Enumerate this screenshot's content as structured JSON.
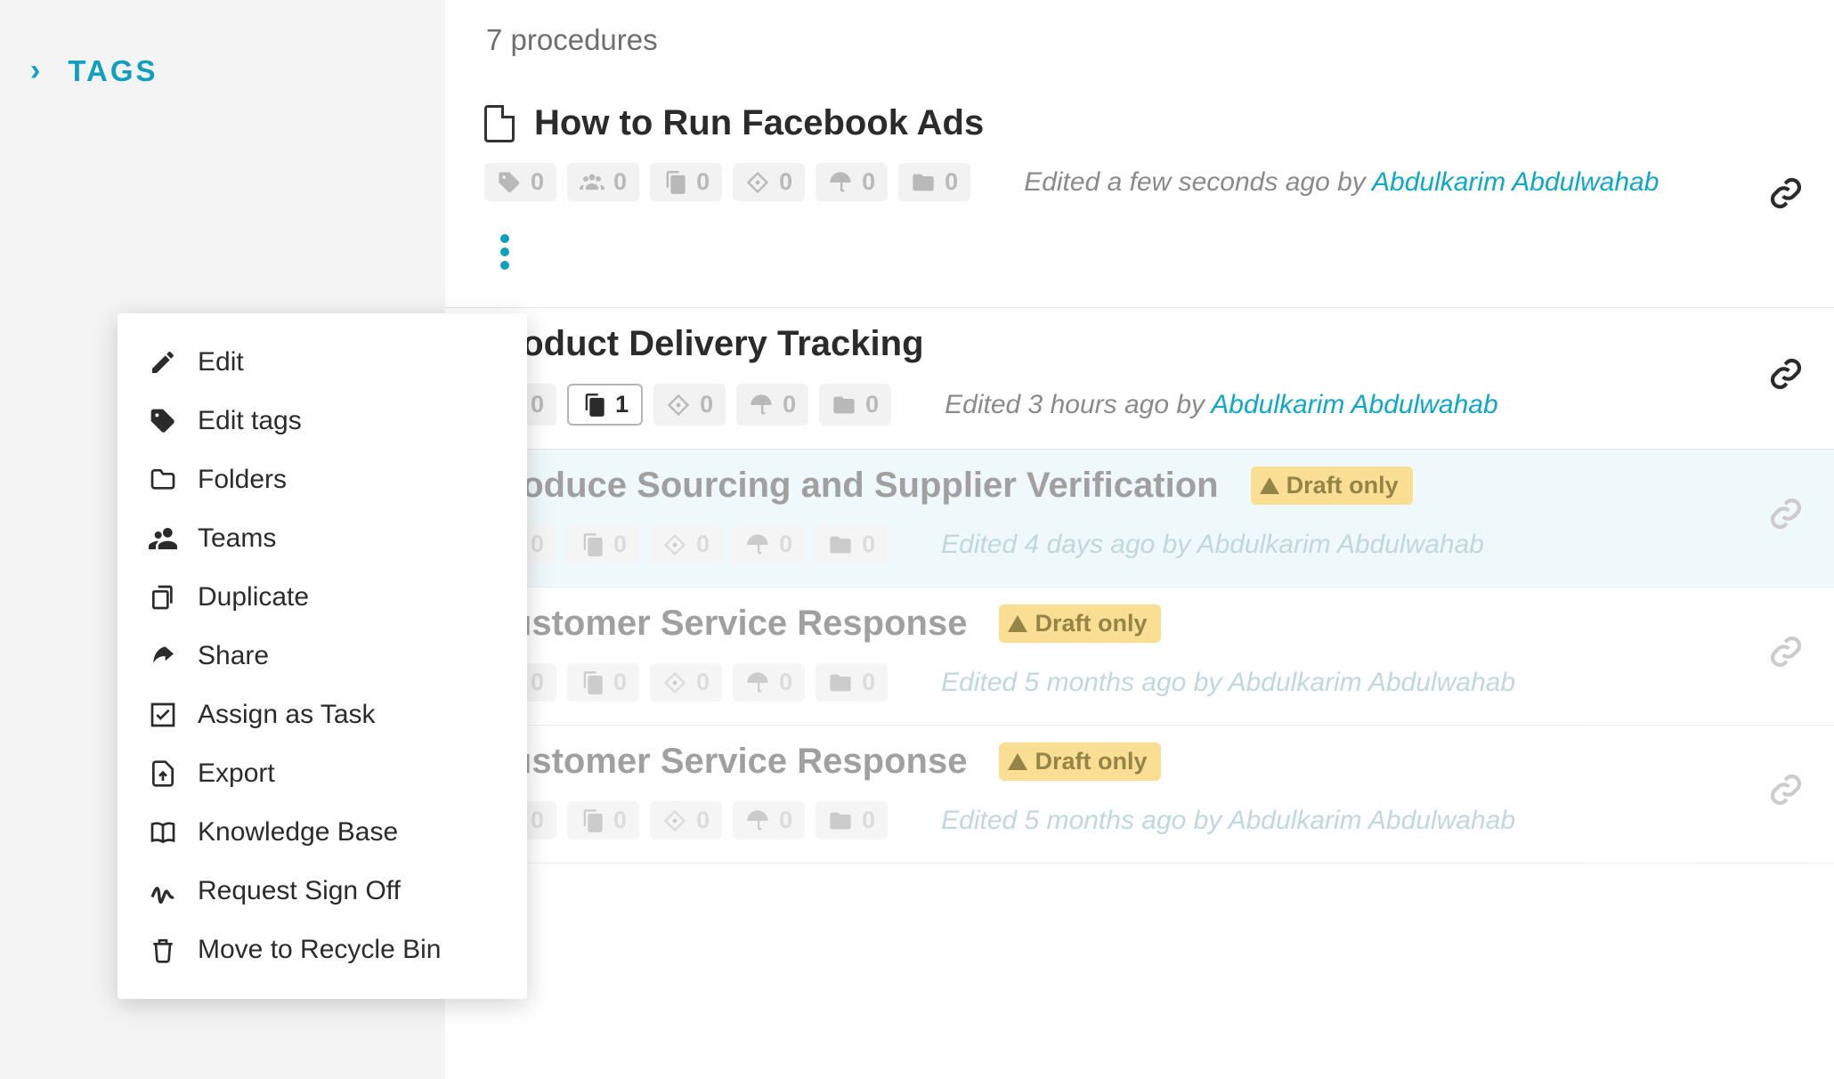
{
  "sidebar": {
    "tags_label": "TAGS"
  },
  "count_label": "7 procedures",
  "user_link": "Abdulkarim Abdulwahab",
  "context_menu": {
    "items": [
      {
        "label": "Edit",
        "icon": "edit"
      },
      {
        "label": "Edit tags",
        "icon": "tag"
      },
      {
        "label": "Folders",
        "icon": "folder"
      },
      {
        "label": "Teams",
        "icon": "users"
      },
      {
        "label": "Duplicate",
        "icon": "copy"
      },
      {
        "label": "Share",
        "icon": "share"
      },
      {
        "label": "Assign as Task",
        "icon": "check"
      },
      {
        "label": "Export",
        "icon": "export"
      },
      {
        "label": "Knowledge Base",
        "icon": "book"
      },
      {
        "label": "Request Sign Off",
        "icon": "sign"
      },
      {
        "label": "Move to Recycle Bin",
        "icon": "trash"
      }
    ]
  },
  "procedures": [
    {
      "title": "How to Run Facebook Ads",
      "stats": {
        "tags": "0",
        "teams": "0",
        "copies": "0",
        "approvals": "0",
        "umbrella": "0",
        "folders": "0"
      },
      "edited_prefix": "Edited a few seconds ago by ",
      "draft": false,
      "show_kebab": true,
      "hide_doc_icon": false
    },
    {
      "title": "Product Delivery Tracking",
      "stats": {
        "tags": "",
        "teams": "0",
        "copies": "1",
        "approvals": "0",
        "umbrella": "0",
        "folders": "0"
      },
      "edited_prefix": "Edited 3 hours ago by ",
      "draft": false,
      "show_kebab": false,
      "copies_active": true,
      "hide_doc_icon": true
    },
    {
      "title": "Produce Sourcing and Supplier Verification",
      "stats": {
        "tags": "",
        "teams": "0",
        "copies": "0",
        "approvals": "0",
        "umbrella": "0",
        "folders": "0"
      },
      "edited_prefix": "Edited 4 days ago by ",
      "draft": true,
      "draft_label": "Draft only",
      "selected": true,
      "hide_doc_icon": true
    },
    {
      "title": "Customer Service Response",
      "stats": {
        "tags": "",
        "teams": "0",
        "copies": "0",
        "approvals": "0",
        "umbrella": "0",
        "folders": "0"
      },
      "edited_prefix": "Edited 5 months ago by ",
      "draft": true,
      "draft_label": "Draft only",
      "hide_doc_icon": true
    },
    {
      "title": "Customer Service Response",
      "stats": {
        "tags": "",
        "teams": "0",
        "copies": "0",
        "approvals": "0",
        "umbrella": "0",
        "folders": "0"
      },
      "edited_prefix": "Edited 5 months ago by ",
      "draft": true,
      "draft_label": "Draft only",
      "hide_doc_icon": true
    }
  ]
}
